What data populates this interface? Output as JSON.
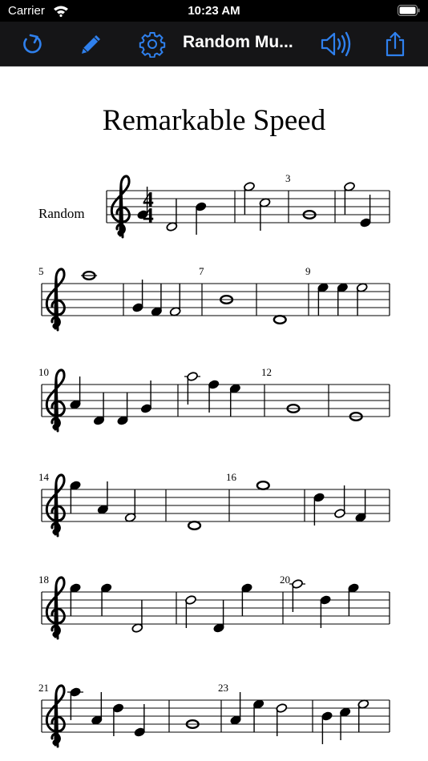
{
  "status_bar": {
    "carrier": "Carrier",
    "time": "10:23 AM"
  },
  "nav_bar": {
    "title": "Random Mu...",
    "buttons": [
      {
        "name": "refresh-button",
        "icon": "refresh-icon"
      },
      {
        "name": "edit-button",
        "icon": "pencil-icon"
      },
      {
        "name": "settings-button",
        "icon": "gear-icon"
      },
      {
        "name": "sound-button",
        "icon": "speaker-icon"
      },
      {
        "name": "share-button",
        "icon": "share-icon"
      }
    ],
    "accent_color": "#2f80ed"
  },
  "score": {
    "title": "Remarkable Speed",
    "part_name": "Random",
    "time_signature": {
      "top": "4",
      "bottom": "4"
    },
    "clef": "treble",
    "systems": [
      {
        "number": "",
        "measures": [
          {
            "number": "",
            "notes": [
              {
                "p": "G4",
                "d": "q"
              },
              {
                "p": "D4",
                "d": "h"
              },
              {
                "p": "B4",
                "d": "q"
              }
            ]
          },
          {
            "number": "",
            "notes": [
              {
                "p": "G5",
                "d": "h"
              },
              {
                "p": "C5",
                "d": "h"
              }
            ]
          },
          {
            "number": "3",
            "notes": [
              {
                "p": "G4",
                "d": "w"
              }
            ]
          },
          {
            "number": "",
            "notes": [
              {
                "p": "G5",
                "d": "h"
              },
              {
                "p": "E4",
                "d": "q"
              }
            ]
          }
        ]
      },
      {
        "number": "5",
        "measures": [
          {
            "number": "",
            "notes": [
              {
                "p": "A5",
                "d": "w"
              }
            ]
          },
          {
            "number": "",
            "notes": [
              {
                "p": "G4",
                "d": "q"
              },
              {
                "p": "F4",
                "d": "q"
              },
              {
                "p": "F4",
                "d": "h"
              }
            ]
          },
          {
            "number": "7",
            "notes": [
              {
                "p": "B4",
                "d": "w"
              }
            ]
          },
          {
            "number": "",
            "notes": [
              {
                "p": "D4",
                "d": "w"
              }
            ]
          },
          {
            "number": "9",
            "notes": [
              {
                "p": "E5",
                "d": "q"
              },
              {
                "p": "E5",
                "d": "q"
              },
              {
                "p": "E5",
                "d": "h"
              }
            ]
          }
        ]
      },
      {
        "number": "10",
        "measures": [
          {
            "number": "",
            "notes": [
              {
                "p": "A4",
                "d": "q"
              },
              {
                "p": "D4",
                "d": "q"
              },
              {
                "p": "D4",
                "d": "q"
              },
              {
                "p": "G4",
                "d": "q"
              }
            ]
          },
          {
            "number": "",
            "notes": [
              {
                "p": "A5",
                "d": "h"
              },
              {
                "p": "F5",
                "d": "q"
              },
              {
                "p": "E5",
                "d": "q"
              }
            ]
          },
          {
            "number": "12",
            "notes": [
              {
                "p": "G4",
                "d": "w"
              }
            ]
          },
          {
            "number": "",
            "notes": [
              {
                "p": "E4",
                "d": "w"
              }
            ]
          }
        ]
      },
      {
        "number": "14",
        "measures": [
          {
            "number": "",
            "notes": [
              {
                "p": "G5",
                "d": "q"
              },
              {
                "p": "A4",
                "d": "q"
              },
              {
                "p": "F4",
                "d": "h"
              }
            ]
          },
          {
            "number": "",
            "notes": [
              {
                "p": "D4",
                "d": "w"
              }
            ]
          },
          {
            "number": "16",
            "notes": [
              {
                "p": "G5",
                "d": "w"
              }
            ]
          },
          {
            "number": "",
            "notes": [
              {
                "p": "D5",
                "d": "q"
              },
              {
                "p": "G4",
                "d": "h"
              },
              {
                "p": "F4",
                "d": "q"
              }
            ]
          }
        ]
      },
      {
        "number": "18",
        "measures": [
          {
            "number": "",
            "notes": [
              {
                "p": "G5",
                "d": "q"
              },
              {
                "p": "G5",
                "d": "q"
              },
              {
                "p": "D4",
                "d": "h"
              }
            ]
          },
          {
            "number": "",
            "notes": [
              {
                "p": "D5",
                "d": "h"
              },
              {
                "p": "D4",
                "d": "q"
              },
              {
                "p": "G5",
                "d": "q"
              }
            ]
          },
          {
            "number": "20",
            "notes": [
              {
                "p": "A5",
                "d": "h"
              },
              {
                "p": "D5",
                "d": "q"
              },
              {
                "p": "G5",
                "d": "q"
              }
            ]
          }
        ]
      },
      {
        "number": "21",
        "measures": [
          {
            "number": "",
            "notes": [
              {
                "p": "A5",
                "d": "q"
              },
              {
                "p": "A4",
                "d": "q"
              },
              {
                "p": "D5",
                "d": "q"
              },
              {
                "p": "E4",
                "d": "q"
              }
            ]
          },
          {
            "number": "",
            "notes": [
              {
                "p": "G4",
                "d": "w"
              }
            ]
          },
          {
            "number": "23",
            "notes": [
              {
                "p": "A4",
                "d": "q"
              },
              {
                "p": "E5",
                "d": "q"
              },
              {
                "p": "D5",
                "d": "h"
              }
            ]
          },
          {
            "number": "",
            "notes": [
              {
                "p": "B4",
                "d": "q"
              },
              {
                "p": "C5",
                "d": "q"
              },
              {
                "p": "E5",
                "d": "h"
              }
            ]
          }
        ]
      }
    ]
  }
}
